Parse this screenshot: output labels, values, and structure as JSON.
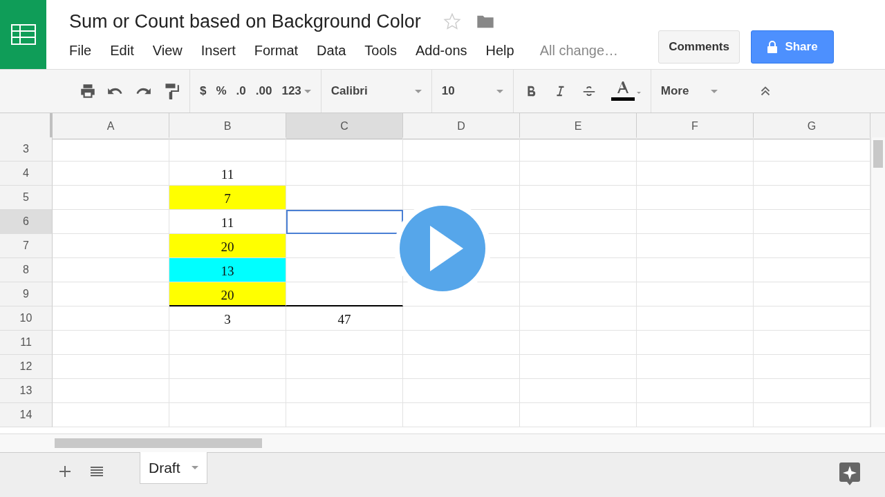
{
  "document": {
    "title": "Sum or Count based on Background Color",
    "starred": false
  },
  "menu": [
    {
      "label": "File"
    },
    {
      "label": "Edit"
    },
    {
      "label": "View"
    },
    {
      "label": "Insert"
    },
    {
      "label": "Format"
    },
    {
      "label": "Data"
    },
    {
      "label": "Tools"
    },
    {
      "label": "Add-ons"
    },
    {
      "label": "Help"
    }
  ],
  "save_status": "All change…",
  "buttons": {
    "comments": "Comments",
    "share": "Share"
  },
  "toolbar": {
    "currency": "$",
    "percent": "%",
    "decrease_decimals": ".0",
    "increase_decimals": ".00",
    "number_format": "123",
    "font": "Calibri",
    "font_size": "10",
    "more": "More"
  },
  "columns": [
    {
      "label": "A",
      "selected": false
    },
    {
      "label": "B",
      "selected": false
    },
    {
      "label": "C",
      "selected": true
    },
    {
      "label": "D",
      "selected": false
    },
    {
      "label": "E",
      "selected": false
    },
    {
      "label": "F",
      "selected": false
    },
    {
      "label": "G",
      "selected": false
    }
  ],
  "rows": [
    {
      "label": "3",
      "selected": false
    },
    {
      "label": "4",
      "selected": false,
      "b": {
        "text": "11"
      }
    },
    {
      "label": "5",
      "selected": false,
      "b": {
        "text": "7",
        "color": "#ffff00"
      }
    },
    {
      "label": "6",
      "selected": true,
      "b": {
        "text": "11"
      },
      "c": {
        "active": true
      }
    },
    {
      "label": "7",
      "selected": false,
      "b": {
        "text": "20",
        "color": "#ffff00"
      }
    },
    {
      "label": "8",
      "selected": false,
      "b": {
        "text": "13",
        "color": "#00ffff"
      }
    },
    {
      "label": "9",
      "selected": false,
      "b": {
        "text": "20",
        "color": "#ffff00",
        "border_bottom": true
      },
      "c": {
        "border_bottom": true
      }
    },
    {
      "label": "10",
      "selected": false,
      "b": {
        "text": "3"
      },
      "c": {
        "text": "47"
      }
    },
    {
      "label": "11",
      "selected": false
    },
    {
      "label": "12",
      "selected": false
    },
    {
      "label": "13",
      "selected": false
    },
    {
      "label": "14",
      "selected": false
    }
  ],
  "sheets": [
    {
      "label": "Draft",
      "selected": true
    }
  ]
}
